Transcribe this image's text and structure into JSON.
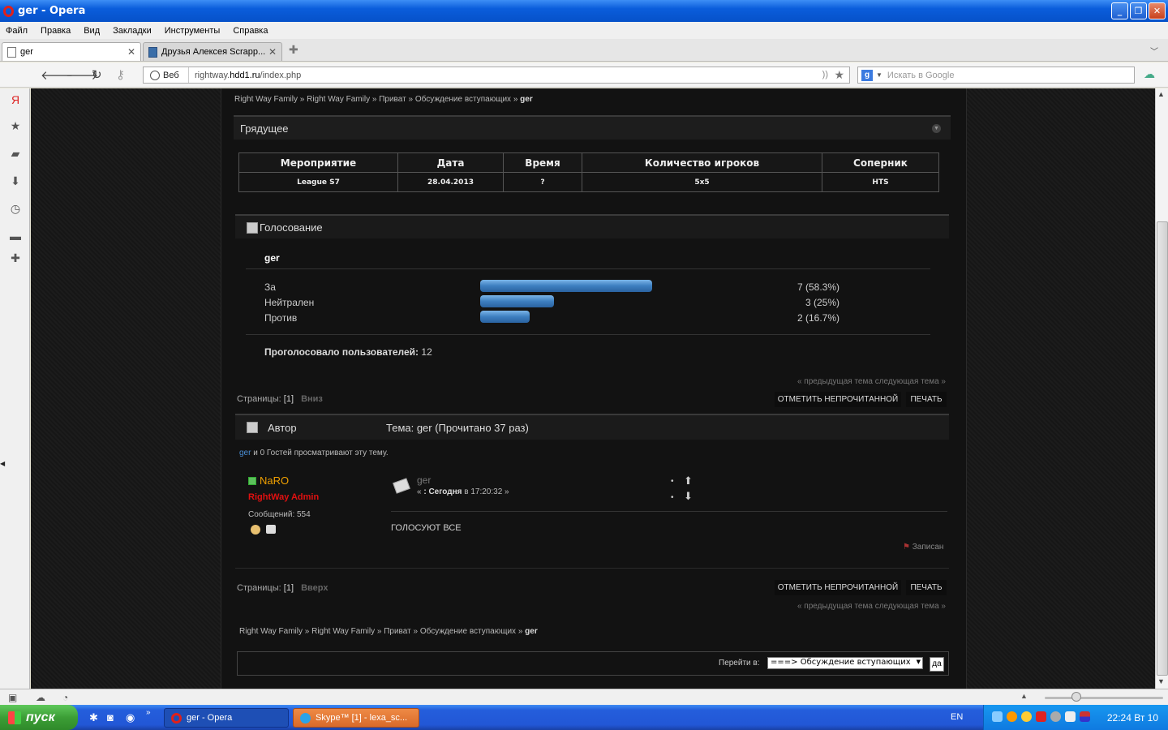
{
  "window": {
    "title": "ger - Opera"
  },
  "menu": [
    "Файл",
    "Правка",
    "Вид",
    "Закладки",
    "Инструменты",
    "Справка"
  ],
  "tabs": [
    {
      "label": "ger",
      "active": true
    },
    {
      "label": "Друзья Алексея Scrapp...",
      "active": false
    }
  ],
  "address": {
    "web_label": "Веб",
    "url_prefix": "rightway.",
    "url_domain": "hdd1.ru",
    "url_path": "/index.php",
    "search_placeholder": "Искать в Google"
  },
  "breadcrumb": {
    "items": [
      "Right Way Family",
      "Right Way Family",
      "Приват",
      "Обсуждение вступающих"
    ],
    "current": "ger",
    "sep": "»"
  },
  "upcoming": {
    "title": "Грядущее",
    "headers": [
      "Мероприятие",
      "Дата",
      "Время",
      "Количество игроков",
      "Соперник"
    ],
    "row": [
      "League S7",
      "28.04.2013",
      "?",
      "5x5",
      "HTS"
    ]
  },
  "poll": {
    "title": "Голосование",
    "question": "ger",
    "options": [
      {
        "label": "За",
        "votes": "7 (58.3%)",
        "percent": 58.3
      },
      {
        "label": "Нейтрален",
        "votes": "3 (25%)",
        "percent": 25
      },
      {
        "label": "Против",
        "votes": "2 (16.7%)",
        "percent": 16.7
      }
    ],
    "total_label": "Проголосовало пользователей:",
    "total_value": "12"
  },
  "topic_nav": {
    "prev_next": "« предыдущая тема следующая тема »"
  },
  "pagination": {
    "label": "Страницы:",
    "current": "[1]",
    "down": "Вниз",
    "up": "Вверх"
  },
  "buttons": {
    "mark_unread": "ОТМЕТИТЬ НЕПРОЧИТАННОЙ",
    "print": "ПЕЧАТЬ"
  },
  "thread": {
    "author_col": "Автор",
    "topic_label": "Тема: ger  (Прочитано 37 раз)",
    "viewers_user": "ger",
    "viewers_rest": " и 0 Гостей просматривают эту тему."
  },
  "post": {
    "username": "NaRO",
    "rank": "RightWay Admin",
    "messages": "Сообщений: 554",
    "title": "ger",
    "date_prefix": "« ",
    "date_bold": ": Сегодня",
    "date_rest": " в 17:20:32 »",
    "body": "ГОЛОСУЮТ ВСЕ",
    "logged": "Записан"
  },
  "jump": {
    "label": "Перейти в:",
    "selected": "===> Обсуждение вступающих",
    "go": "да"
  },
  "taskbar": {
    "start": "пуск",
    "tasks": [
      "ger - Opera",
      "Skype™ [1] - lexa_sc..."
    ],
    "lang": "EN",
    "clock": "22:24 Вт 10"
  },
  "colors": {
    "accent": "#4a8fd6",
    "username": "#f0a000",
    "rank": "#e01010",
    "bar": "#3d7fc0"
  }
}
